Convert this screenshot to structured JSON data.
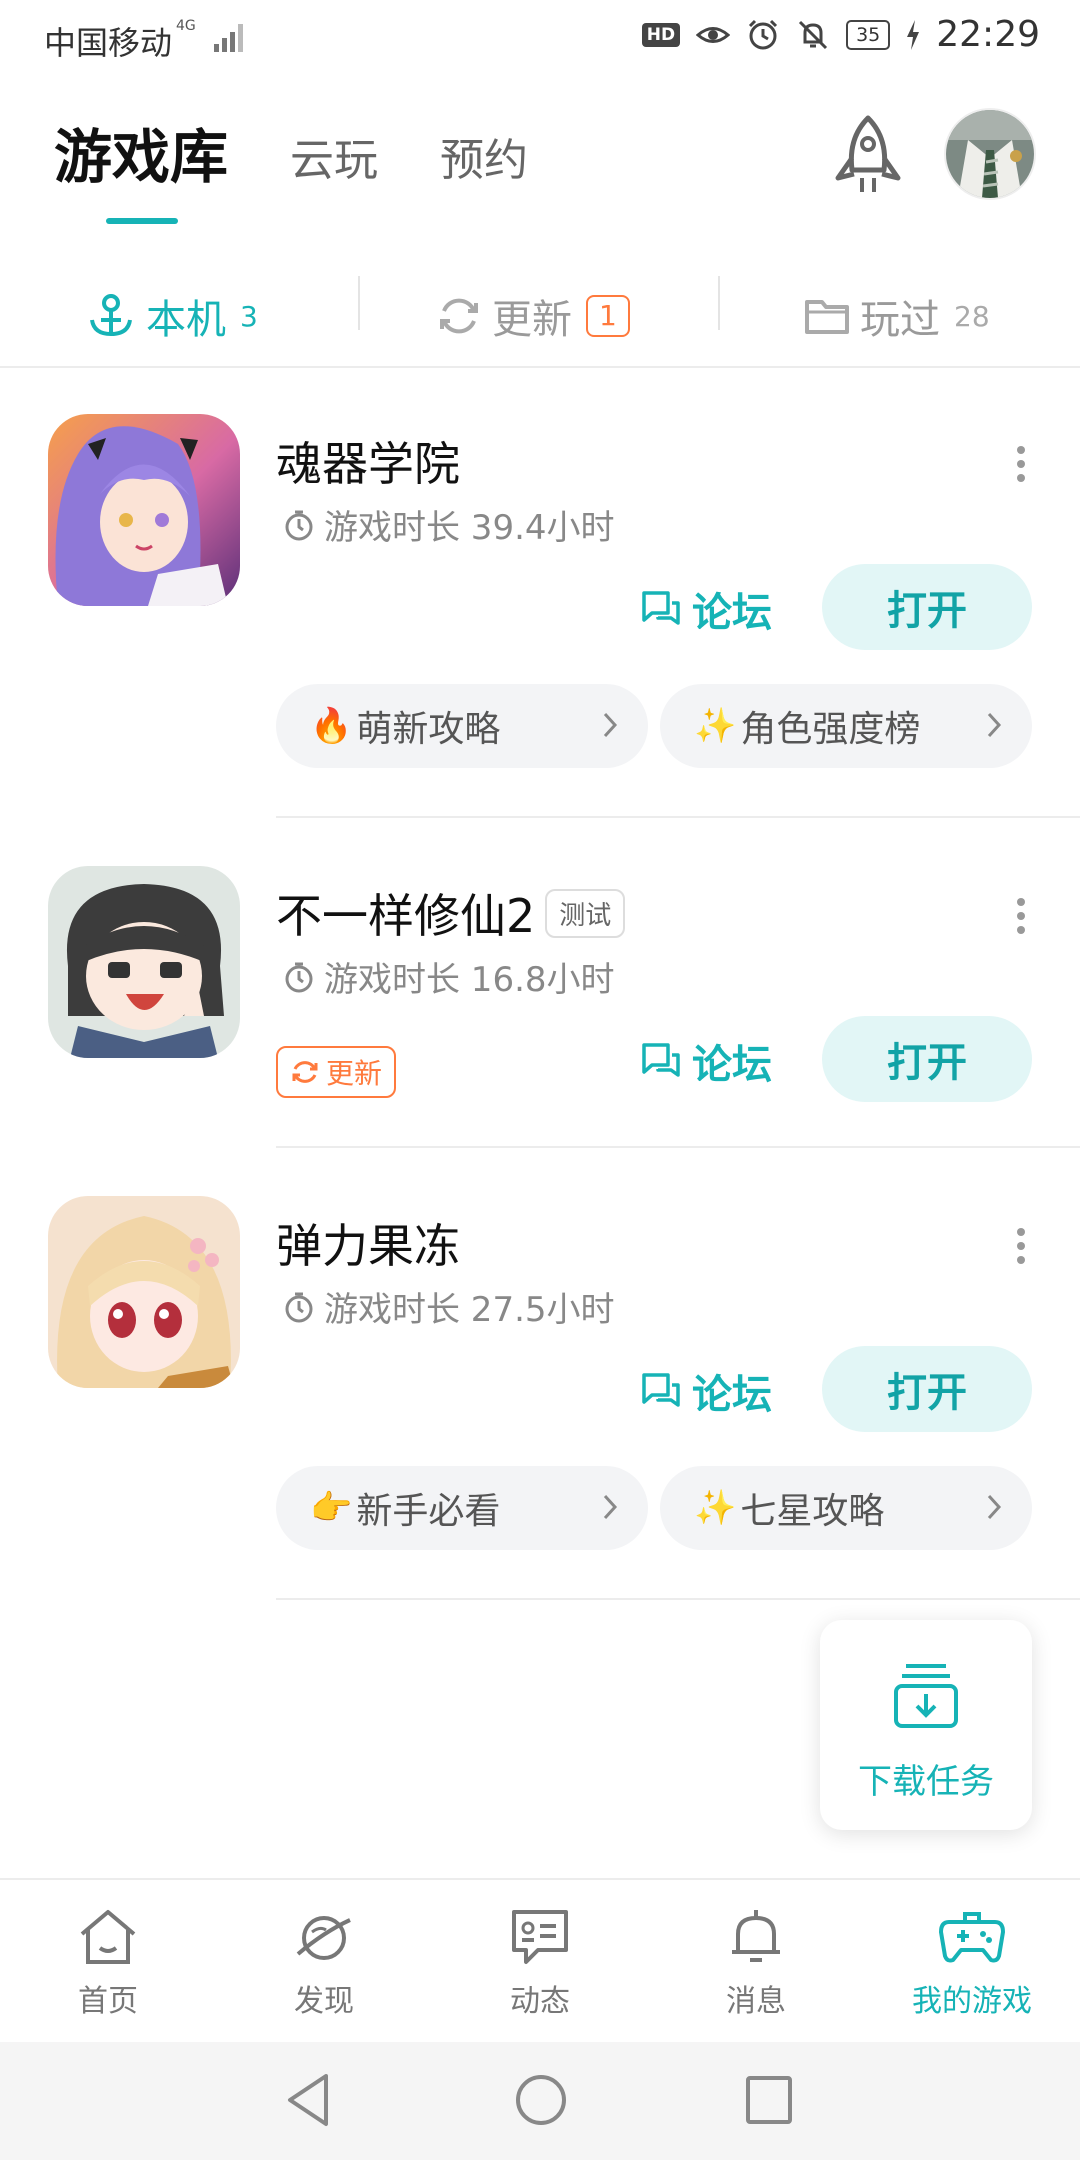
{
  "status_bar": {
    "carrier": "中国移动",
    "network": "4G",
    "hd": "HD",
    "battery": "35",
    "time": "22:29"
  },
  "top_tabs": [
    {
      "label": "游戏库",
      "active": true
    },
    {
      "label": "云玩",
      "active": false
    },
    {
      "label": "预约",
      "active": false
    }
  ],
  "sub_tabs": {
    "local": {
      "label": "本机",
      "count": "3"
    },
    "update": {
      "label": "更新",
      "badge": "1"
    },
    "played": {
      "label": "玩过",
      "count": "28"
    }
  },
  "games": [
    {
      "name": "魂器学院",
      "tag": "",
      "playtime": "游戏时长 39.4小时",
      "forum": "论坛",
      "open": "打开",
      "chips": [
        {
          "emoji": "🔥",
          "label": "萌新攻略"
        },
        {
          "emoji": "✨",
          "label": "角色强度榜"
        }
      ]
    },
    {
      "name": "不一样修仙2",
      "tag": "测试",
      "playtime": "游戏时长 16.8小时",
      "update_badge": "更新",
      "forum": "论坛",
      "open": "打开"
    },
    {
      "name": "弹力果冻",
      "tag": "",
      "playtime": "游戏时长 27.5小时",
      "forum": "论坛",
      "open": "打开",
      "chips": [
        {
          "emoji": "👉",
          "label": "新手必看"
        },
        {
          "emoji": "✨",
          "label": "七星攻略"
        }
      ]
    }
  ],
  "download_tasks": "下载任务",
  "bottom_nav": [
    {
      "label": "首页",
      "icon": "home-icon"
    },
    {
      "label": "发现",
      "icon": "planet-icon"
    },
    {
      "label": "动态",
      "icon": "feed-icon"
    },
    {
      "label": "消息",
      "icon": "bell-icon"
    },
    {
      "label": "我的游戏",
      "icon": "gamepad-icon",
      "active": true
    }
  ],
  "colors": {
    "accent": "#16b3b6",
    "update_orange": "#ff7a3d",
    "open_button_bg": "#e2f6f6"
  }
}
